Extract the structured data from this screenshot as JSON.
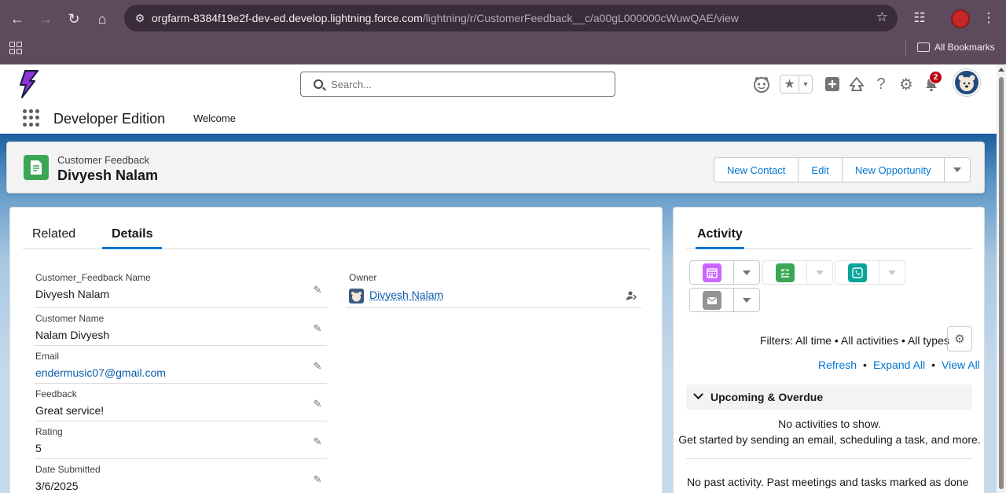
{
  "browser": {
    "url_host": "orgfarm-8384f19e2f-dev-ed.develop.lightning.force.com",
    "url_path": "/lightning/r/CustomerFeedback__c/a00gL000000cWuwQAE/view",
    "bookmarks_label": "All Bookmarks"
  },
  "header": {
    "search_placeholder": "Search...",
    "notification_count": "2",
    "app_name": "Developer Edition",
    "nav_items": [
      "Welcome"
    ]
  },
  "record": {
    "object_label": "Customer Feedback",
    "name": "Divyesh Nalam",
    "actions": [
      "New Contact",
      "Edit",
      "New Opportunity"
    ],
    "icon_color": "#3ba755"
  },
  "details": {
    "tabs": [
      "Related",
      "Details"
    ],
    "active_tab": "Details",
    "fields": [
      {
        "label": "Customer_Feedback Name",
        "value": "Divyesh Nalam"
      },
      {
        "label": "Customer Name",
        "value": "Nalam Divyesh"
      },
      {
        "label": "Email",
        "value": "endermusic07@gmail.com"
      },
      {
        "label": "Feedback",
        "value": "Great service!"
      },
      {
        "label": "Rating",
        "value": "5"
      },
      {
        "label": "Date Submitted",
        "value": "3/6/2025"
      }
    ],
    "owner": {
      "label": "Owner",
      "value": "Divyesh Nalam"
    }
  },
  "activity": {
    "tab": "Activity",
    "filters": "Filters: All time • All activities • All types",
    "links": [
      "Refresh",
      "Expand All",
      "View All"
    ],
    "upcoming_title": "Upcoming & Overdue",
    "empty_line1": "No activities to show.",
    "empty_line2": "Get started by sending an email, scheduling a task, and more.",
    "past_text": "No past activity. Past meetings and tasks marked as done show up here."
  },
  "colors": {
    "brand_blue": "#0176d3",
    "event": "#cb65ff",
    "task": "#3ba755",
    "call": "#06a59a",
    "email": "#939393"
  }
}
